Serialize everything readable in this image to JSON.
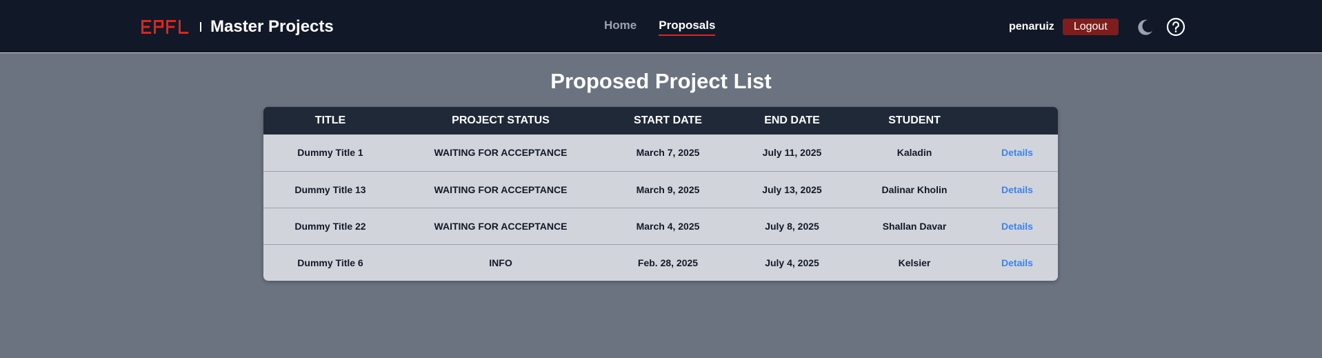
{
  "header": {
    "logo_text": "EPFL",
    "title": "Master Projects",
    "nav": [
      {
        "label": "Home",
        "active": false
      },
      {
        "label": "Proposals",
        "active": true
      }
    ],
    "username": "penaruiz",
    "logout_label": "Logout",
    "theme_icon": "moon-icon",
    "help_icon": "help-circle-icon",
    "colors": {
      "logo_red": "#e2231a",
      "logout_bg": "#7f1d1d",
      "active_underline": "#dc2626",
      "link_blue": "#3b82f6"
    }
  },
  "page": {
    "title": "Proposed Project List"
  },
  "table": {
    "columns": [
      "TITLE",
      "PROJECT STATUS",
      "START DATE",
      "END DATE",
      "STUDENT",
      ""
    ],
    "rows": [
      {
        "title": "Dummy Title 1",
        "status": "WAITING FOR ACCEPTANCE",
        "start": "March 7, 2025",
        "end": "July 11, 2025",
        "student": "Kaladin",
        "action": "Details"
      },
      {
        "title": "Dummy Title 13",
        "status": "WAITING FOR ACCEPTANCE",
        "start": "March 9, 2025",
        "end": "July 13, 2025",
        "student": "Dalinar Kholin",
        "action": "Details"
      },
      {
        "title": "Dummy Title 22",
        "status": "WAITING FOR ACCEPTANCE",
        "start": "March 4, 2025",
        "end": "July 8, 2025",
        "student": "Shallan Davar",
        "action": "Details"
      },
      {
        "title": "Dummy Title 6",
        "status": "INFO",
        "start": "Feb. 28, 2025",
        "end": "July 4, 2025",
        "student": "Kelsier",
        "action": "Details"
      }
    ]
  }
}
